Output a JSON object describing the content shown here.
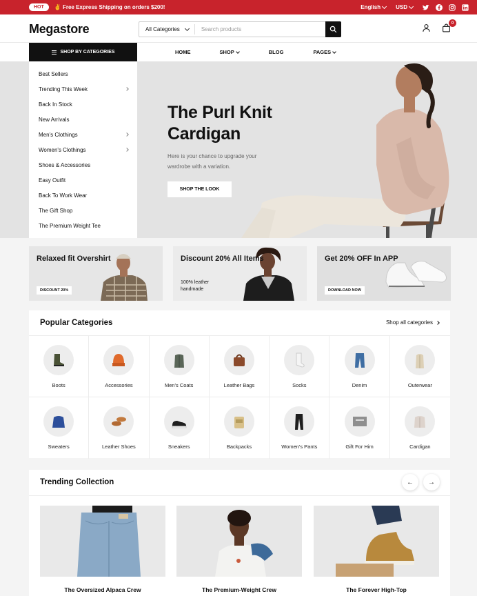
{
  "topbar": {
    "badge": "HOT",
    "promo": "✌ Free Express Shipping on orders $200!",
    "language": "English",
    "currency": "USD",
    "social_icons": [
      "twitter-icon",
      "facebook-icon",
      "instagram-icon",
      "linkedin-icon"
    ]
  },
  "header": {
    "logo": "Megastore",
    "search_category": "All Categories",
    "search_placeholder": "Search products",
    "cart_count": "0"
  },
  "nav": {
    "categories_button": "SHOP BY CATEGORIES",
    "links": [
      "HOME",
      "SHOP",
      "BLOG",
      "PAGES"
    ]
  },
  "sidebar": {
    "items": [
      {
        "label": "Best Sellers",
        "has_sub": false
      },
      {
        "label": "Trending This Week",
        "has_sub": true
      },
      {
        "label": "Back In Stock",
        "has_sub": false
      },
      {
        "label": "New Arrivals",
        "has_sub": false
      },
      {
        "label": "Men's Clothings",
        "has_sub": true
      },
      {
        "label": "Women's Clothings",
        "has_sub": true
      },
      {
        "label": "Shoes & Accessories",
        "has_sub": false
      },
      {
        "label": "Easy Outfit",
        "has_sub": false
      },
      {
        "label": "Back To Work Wear",
        "has_sub": false
      },
      {
        "label": "The Gift Shop",
        "has_sub": false
      },
      {
        "label": "The Premium Weight Tee",
        "has_sub": false
      }
    ]
  },
  "hero": {
    "title": "The Purl Knit Cardigan",
    "subtitle": "Here is your chance to upgrade your wardrobe with a variation.",
    "button": "SHOP THE LOOK"
  },
  "promos": [
    {
      "title": "Relaxed fit Overshirt",
      "tag": "DISCOUNT 20%"
    },
    {
      "title": "Discount 20% All Items",
      "note": "100% leather handmade"
    },
    {
      "title": "Get 20% OFF In APP",
      "tag": "DOWNLOAD NOW"
    }
  ],
  "popular": {
    "title": "Popular Categories",
    "link": "Shop all categories",
    "categories": [
      "Boots",
      "Accessories",
      "Men's Coats",
      "Leather Bags",
      "Socks",
      "Denim",
      "Outerwear",
      "Sweaters",
      "Leather Shoes",
      "Sneakers",
      "Backpacks",
      "Women's Pants",
      "Gift For Him",
      "Cardigan"
    ]
  },
  "trending": {
    "title": "Trending Collection",
    "products": [
      "The Oversized Alpaca Crew",
      "The Premium-Weight Crew",
      "The Forever High-Top"
    ]
  },
  "colors": {
    "accent": "#c8232c",
    "dark": "#111111"
  }
}
